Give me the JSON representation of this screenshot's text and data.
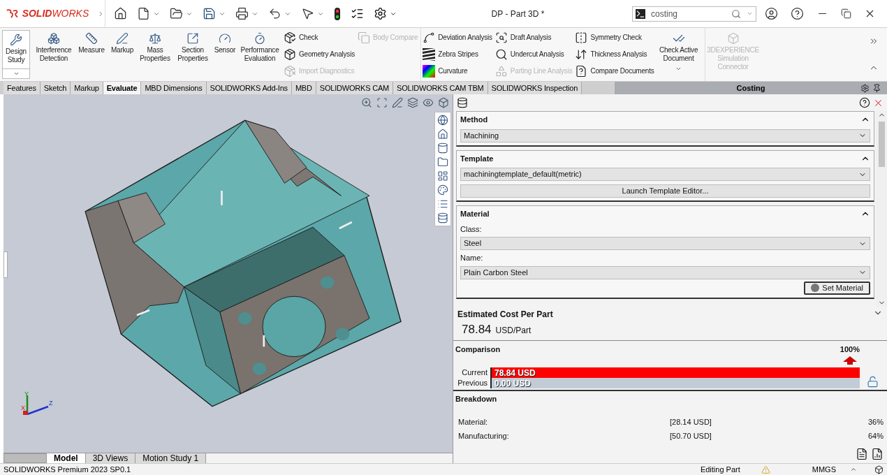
{
  "window": {
    "title": "DP - Part 3D *",
    "logo": "**SOLID**WORKS"
  },
  "search": {
    "value": "costing"
  },
  "ribbon": {
    "columns": [
      {
        "kind": "large",
        "label": "Design Study",
        "dropdown": true,
        "disabled": false
      },
      {
        "kind": "large",
        "label": "Interference Detection",
        "dropdown": false,
        "disabled": false
      },
      {
        "kind": "large",
        "label": "Measure",
        "dropdown": false,
        "disabled": false
      },
      {
        "kind": "large",
        "label": "Markup",
        "dropdown": false,
        "disabled": false
      },
      {
        "kind": "large",
        "label": "Mass Properties",
        "dropdown": false,
        "disabled": false
      },
      {
        "kind": "large",
        "label": "Section Properties",
        "dropdown": false,
        "disabled": false
      },
      {
        "kind": "large",
        "label": "Sensor",
        "dropdown": false,
        "disabled": false
      },
      {
        "kind": "large",
        "label": "Performance Evaluation",
        "dropdown": false,
        "disabled": false
      },
      {
        "kind": "small",
        "items": [
          {
            "label": "Check",
            "disabled": false
          },
          {
            "label": "Geometry Analysis",
            "disabled": false
          },
          {
            "label": "Import Diagnostics",
            "disabled": true
          }
        ]
      },
      {
        "kind": "small",
        "items": [
          {
            "label": "Body Compare",
            "disabled": true
          }
        ]
      },
      {
        "kind": "small",
        "items": [
          {
            "label": "Deviation Analysis",
            "disabled": false
          },
          {
            "label": "Zebra Stripes",
            "disabled": false
          },
          {
            "label": "Curvature",
            "disabled": false
          }
        ]
      },
      {
        "kind": "small",
        "items": [
          {
            "label": "Draft Analysis",
            "disabled": false
          },
          {
            "label": "Undercut Analysis",
            "disabled": false
          },
          {
            "label": "Parting Line Analysis",
            "disabled": true
          }
        ]
      },
      {
        "kind": "small",
        "items": [
          {
            "label": "Symmetry Check",
            "disabled": false
          },
          {
            "label": "Thickness Analysis",
            "disabled": false
          },
          {
            "label": "Compare Documents",
            "disabled": false
          }
        ]
      },
      {
        "kind": "large",
        "label": "Check Active Document",
        "dropdown": true,
        "disabled": false
      },
      {
        "kind": "large",
        "label": "3DEXPERIENCE Simulation Connector",
        "dropdown": false,
        "disabled": true
      }
    ]
  },
  "tabs": [
    {
      "label": "Features",
      "selected": false
    },
    {
      "label": "Sketch",
      "selected": false
    },
    {
      "label": "Markup",
      "selected": false
    },
    {
      "label": "Evaluate",
      "selected": true
    },
    {
      "label": "MBD Dimensions",
      "selected": false
    },
    {
      "label": "SOLIDWORKS Add-Ins",
      "selected": false
    },
    {
      "label": "MBD",
      "selected": false
    },
    {
      "label": "SOLIDWORKS CAM",
      "selected": false
    },
    {
      "label": "SOLIDWORKS CAM TBM",
      "selected": false
    },
    {
      "label": "SOLIDWORKS Inspection",
      "selected": false
    }
  ],
  "viewport": {
    "triad": {
      "x": "X",
      "y": "Y",
      "z": "Z"
    }
  },
  "costing": {
    "title": "Costing",
    "method": {
      "title": "Method",
      "value": "Machining",
      "expanded": true
    },
    "template": {
      "title": "Template",
      "value": "machiningtemplate_default(metric)",
      "button": "Launch Template Editor...",
      "expanded": true
    },
    "material": {
      "title": "Material",
      "class_label": "Class:",
      "class_value": "Steel",
      "name_label": "Name:",
      "name_value": "Plain Carbon Steel",
      "button": "Set Material",
      "expanded": true
    },
    "estimate": {
      "title": "Estimated Cost Per Part",
      "value": "78.84",
      "unit": "USD/Part"
    },
    "comparison": {
      "title": "Comparison",
      "percent": "100%",
      "bars": [
        {
          "label": "Current",
          "value": "78.84 USD",
          "level": 1
        },
        {
          "label": "Previous",
          "value": "0.00 USD",
          "level": 0
        }
      ]
    },
    "breakdown": {
      "title": "Breakdown",
      "rows": [
        {
          "name": "Material:",
          "amount": "[28.14 USD]",
          "share": "36%"
        },
        {
          "name": "Manufacturing:",
          "amount": "[50.70 USD]",
          "share": "64%"
        }
      ]
    }
  },
  "bottom_tabs": [
    {
      "label": "Model",
      "selected": true
    },
    {
      "label": "3D Views",
      "selected": false
    },
    {
      "label": "Motion Study 1",
      "selected": false
    }
  ],
  "status_bar": {
    "product": "SOLIDWORKS Premium 2023 SP0.1",
    "mode": "Editing Part",
    "units": "MMGS"
  }
}
